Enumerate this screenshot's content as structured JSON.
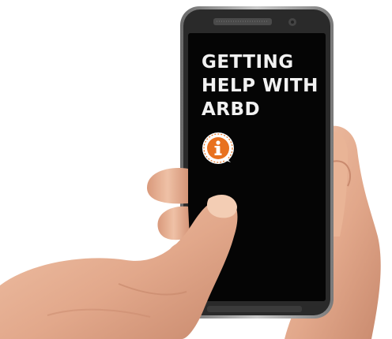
{
  "image": {
    "subject": "hands-holding-smartphone",
    "screen": {
      "title_lines": [
        "GETTING",
        "HELP WITH",
        "ARBD"
      ],
      "badge_icon": "info-icon",
      "colors": {
        "screen_background": "#050505",
        "text": "#f2f2f2",
        "badge_orange": "#e8711f",
        "badge_ring": "#ffffff"
      }
    }
  }
}
